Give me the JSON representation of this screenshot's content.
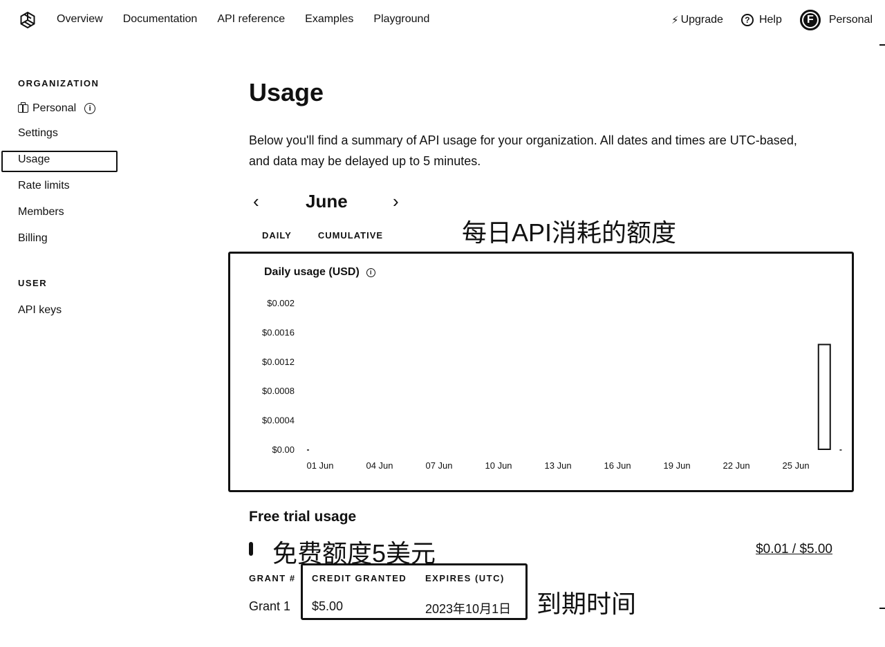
{
  "nav": {
    "links": [
      "Overview",
      "Documentation",
      "API reference",
      "Examples",
      "Playground"
    ],
    "upgrade": "Upgrade",
    "help": "Help",
    "avatar_letter": "F",
    "account": "Personal"
  },
  "sidebar": {
    "org_heading": "ORGANIZATION",
    "org_name": "Personal",
    "items": [
      "Settings",
      "Usage",
      "Rate limits",
      "Members",
      "Billing"
    ],
    "user_heading": "USER",
    "user_items": [
      "API keys"
    ],
    "selected": "Usage"
  },
  "main": {
    "title": "Usage",
    "description": "Below you'll find a summary of API usage for your organization. All dates and times are UTC-based, and data may be delayed up to 5 minutes.",
    "month": "June",
    "tabs": [
      "DAILY",
      "CUMULATIVE"
    ],
    "annotation_daily": "每日API消耗的额度",
    "free_trial": {
      "title": "Free trial usage",
      "annotation": "免费额度5美元",
      "amount": "$0.01 / $5.00",
      "used_fraction": 0.002
    },
    "grants": {
      "headers": [
        "GRANT #",
        "CREDIT GRANTED",
        "EXPIRES (UTC)"
      ],
      "rows": [
        [
          "Grant 1",
          "$5.00",
          "2023年10月1日"
        ]
      ],
      "annotation": "到期时间"
    }
  },
  "chart_data": {
    "type": "bar",
    "title": "Daily usage (USD)",
    "x_labels": [
      "01 Jun",
      "04 Jun",
      "07 Jun",
      "10 Jun",
      "13 Jun",
      "16 Jun",
      "19 Jun",
      "22 Jun",
      "25 Jun"
    ],
    "x": [
      1,
      4,
      7,
      10,
      13,
      16,
      19,
      22,
      25
    ],
    "y_ticks": [
      "$0.002",
      "$0.0016",
      "$0.0012",
      "$0.0008",
      "$0.0004",
      "$0.00"
    ],
    "ylim": [
      0,
      0.002
    ],
    "xlim": [
      1,
      27
    ],
    "values": [
      {
        "day": 26,
        "value": 0.00143
      }
    ],
    "grid": false
  }
}
